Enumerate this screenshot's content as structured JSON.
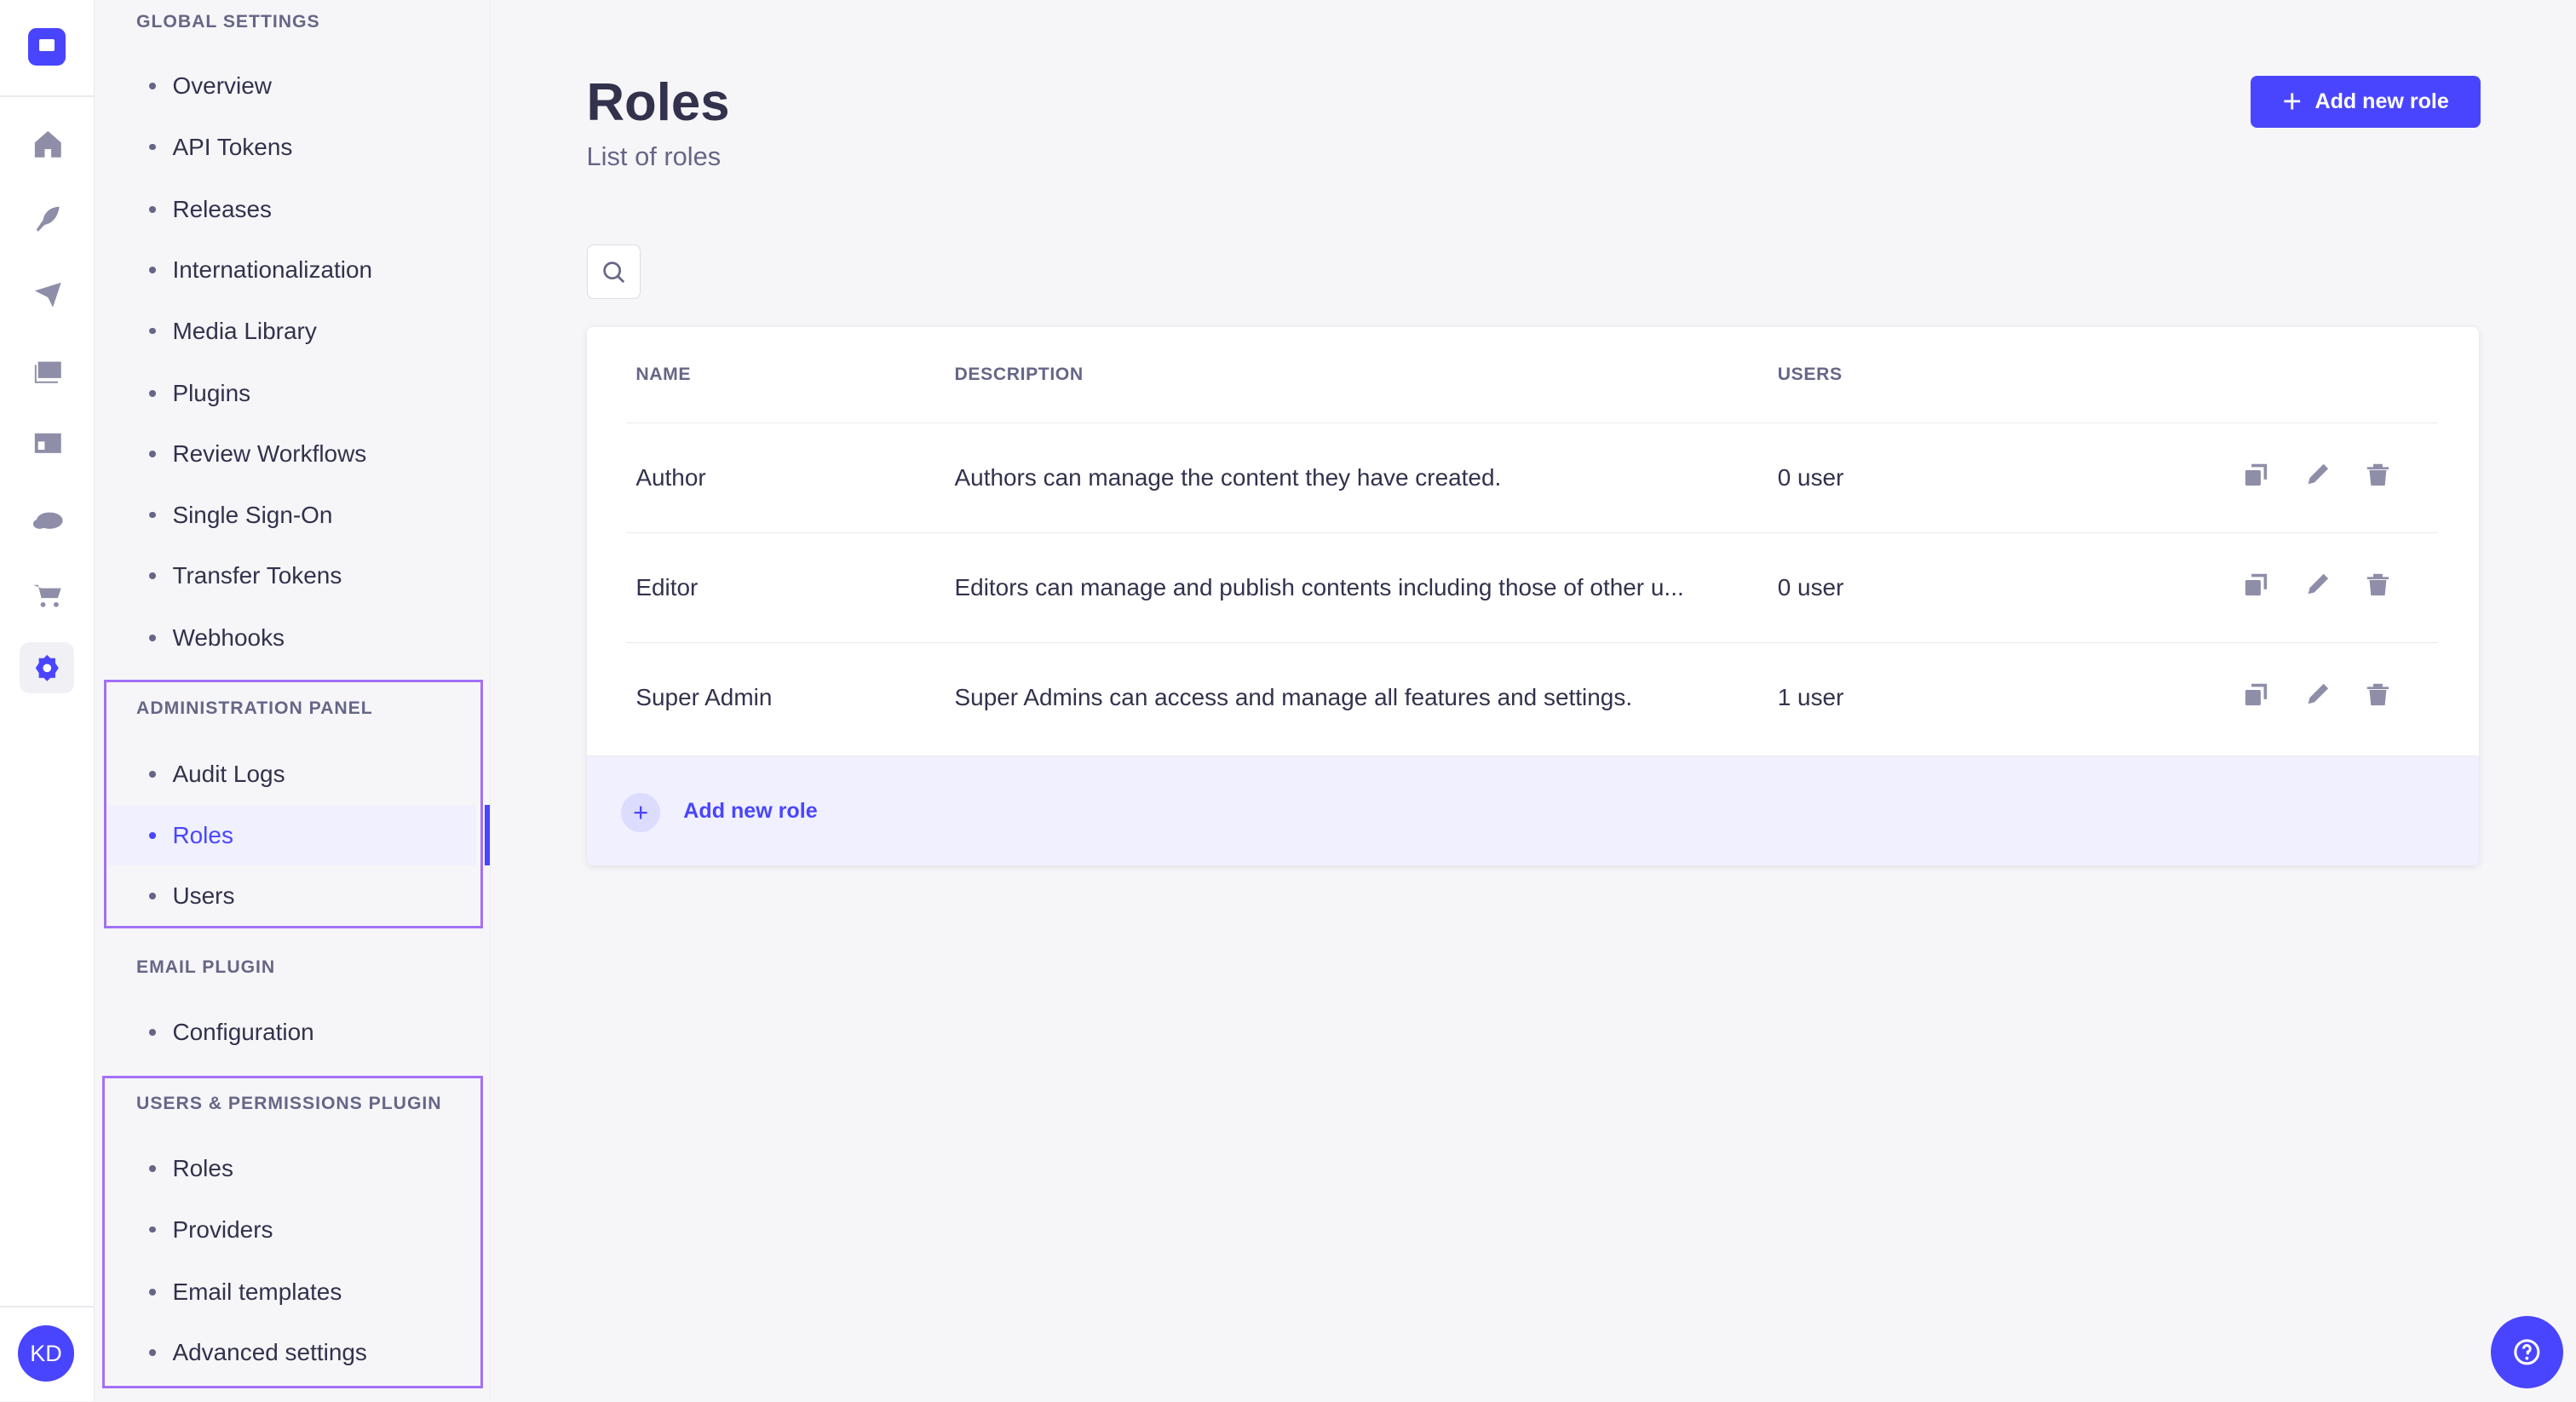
{
  "rail": {
    "icons": [
      "logo",
      "home-icon",
      "feather-icon",
      "paper-plane-icon",
      "media-icon",
      "layout-icon",
      "cloud-icon",
      "cart-icon",
      "settings-icon"
    ],
    "avatar": "KD"
  },
  "subnav": {
    "sections": [
      {
        "title": "GLOBAL SETTINGS",
        "items": [
          "Overview",
          "API Tokens",
          "Releases",
          "Internationalization",
          "Media Library",
          "Plugins",
          "Review Workflows",
          "Single Sign-On",
          "Transfer Tokens",
          "Webhooks"
        ]
      },
      {
        "title": "ADMINISTRATION PANEL",
        "items": [
          "Audit Logs",
          "Roles",
          "Users"
        ]
      },
      {
        "title": "EMAIL PLUGIN",
        "items": [
          "Configuration"
        ]
      },
      {
        "title": "USERS & PERMISSIONS PLUGIN",
        "items": [
          "Roles",
          "Providers",
          "Email templates",
          "Advanced settings"
        ]
      }
    ],
    "active": "Roles"
  },
  "header": {
    "title": "Roles",
    "subtitle": "List of roles",
    "add_label": "Add new role"
  },
  "table": {
    "columns": [
      "NAME",
      "DESCRIPTION",
      "USERS"
    ],
    "rows": [
      {
        "name": "Author",
        "description": "Authors can manage the content they have created.",
        "users": "0 user"
      },
      {
        "name": "Editor",
        "description": "Editors can manage and publish contents including those of other u...",
        "users": "0 user"
      },
      {
        "name": "Super Admin",
        "description": "Super Admins can access and manage all features and settings.",
        "users": "1 user"
      }
    ],
    "footer_add_label": "Add new role"
  },
  "colors": {
    "accent": "#4945ff",
    "highlight": "#a470f5"
  }
}
